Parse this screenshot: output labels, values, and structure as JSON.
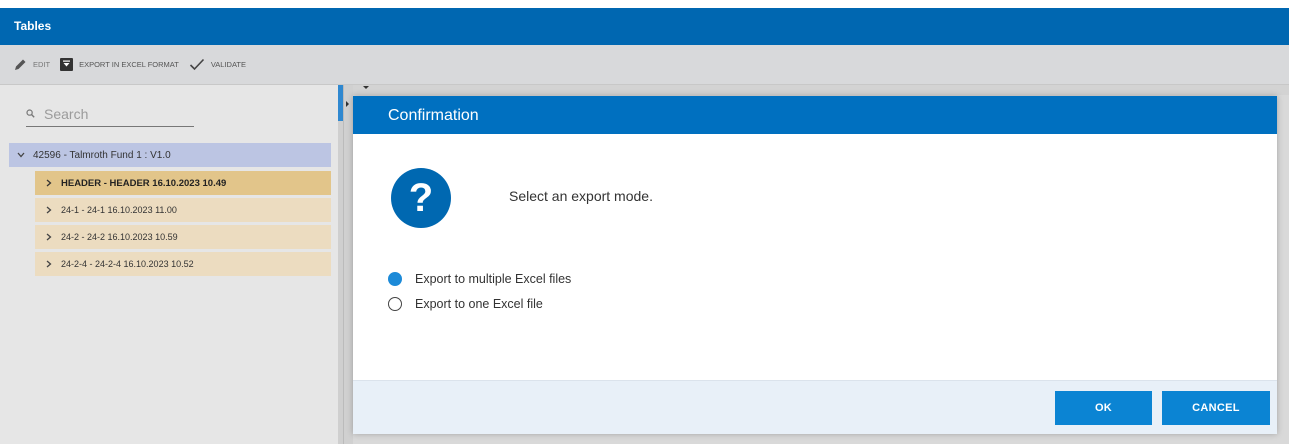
{
  "app": {
    "title": "Tables"
  },
  "toolbar": {
    "edit_label": "EDIT",
    "export_label": "EXPORT IN EXCEL FORMAT",
    "validate_label": "VALIDATE"
  },
  "search": {
    "placeholder": "Search"
  },
  "tree": {
    "root_label": "42596 - Talmroth Fund 1 : V1.0",
    "items": [
      {
        "label": "HEADER - HEADER 16.10.2023 10.49",
        "selected": true
      },
      {
        "label": "24-1 - 24-1 16.10.2023 11.00",
        "selected": false
      },
      {
        "label": "24-2 - 24-2 16.10.2023 10.59",
        "selected": false
      },
      {
        "label": "24-2-4 - 24-2-4 16.10.2023 10.52",
        "selected": false
      }
    ]
  },
  "dialog": {
    "title": "Confirmation",
    "icon": "question-icon",
    "icon_glyph": "?",
    "message": "Select an export mode.",
    "options": [
      {
        "label": "Export to multiple Excel files",
        "checked": true
      },
      {
        "label": "Export to one Excel file",
        "checked": false
      }
    ],
    "ok_label": "OK",
    "cancel_label": "CANCEL"
  },
  "colors": {
    "header_blue": "#0067b1",
    "dialog_header": "#0070c0",
    "button_blue": "#0b84d3",
    "selected_tree_item": "#e2c58a",
    "tree_item": "#ecdcc0",
    "tree_root": "#bcc5e3"
  }
}
